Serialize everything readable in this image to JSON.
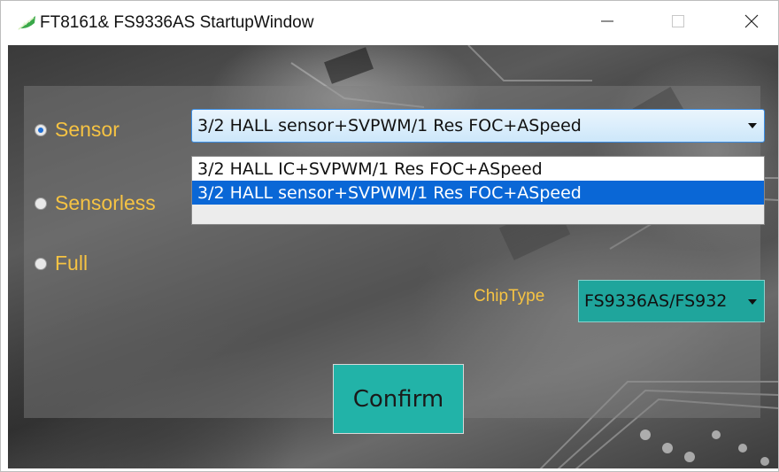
{
  "window": {
    "title": "FT8161& FS9336AS StartupWindow",
    "app_icon": "leaf-logo-icon",
    "controls": [
      "minimize-icon",
      "maximize-icon",
      "close-icon"
    ]
  },
  "modes": [
    {
      "label": "Sensor",
      "checked": true
    },
    {
      "label": "Sensorless",
      "checked": false
    },
    {
      "label": "Full",
      "checked": false
    }
  ],
  "algorithm_combo": {
    "selected": "3/2 HALL sensor+SVPWM/1 Res FOC+ASpeed",
    "options": [
      "3/2 HALL IC+SVPWM/1 Res FOC+ASpeed",
      "3/2 HALL sensor+SVPWM/1 Res FOC+ASpeed"
    ],
    "highlighted_index": 1
  },
  "chip": {
    "label": "ChipType",
    "selected": "FS9336AS/FS932"
  },
  "confirm": {
    "label": "Confirm"
  },
  "colors": {
    "label_text": "#f6c343",
    "accent_teal": "#22b3a8",
    "selection_blue": "#0a67d6"
  }
}
